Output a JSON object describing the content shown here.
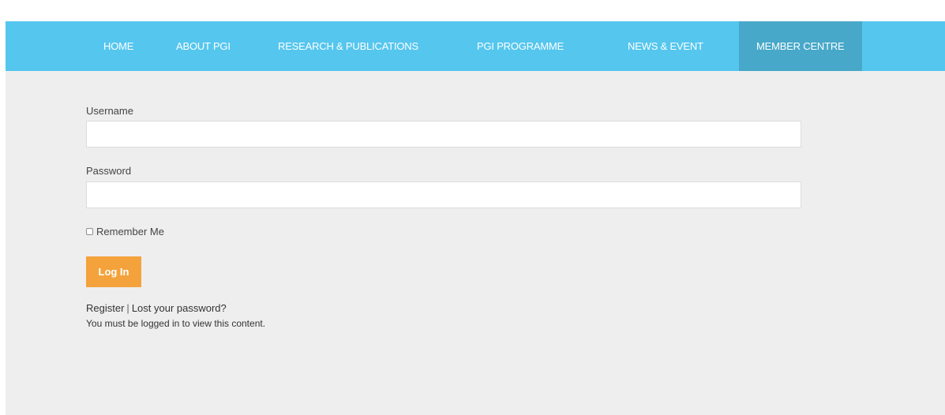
{
  "nav": {
    "items": [
      {
        "label": "HOME"
      },
      {
        "label": "ABOUT PGI"
      },
      {
        "label": "RESEARCH & PUBLICATIONS"
      },
      {
        "label": "PGI PROGRAMME"
      },
      {
        "label": "NEWS & EVENT"
      },
      {
        "label": "MEMBER CENTRE",
        "active": true
      }
    ]
  },
  "form": {
    "username_label": "Username",
    "username_value": "",
    "password_label": "Password",
    "password_value": "",
    "remember_label": "Remember Me",
    "login_label": "Log In"
  },
  "links": {
    "register": "Register",
    "separator": "|",
    "lost_password": "Lost your password?"
  },
  "notice": "You must be logged in to view this content.",
  "colors": {
    "nav_bg": "#55c6ee",
    "nav_active_bg": "#47a8c9",
    "page_bg": "#eeeeee",
    "button_bg": "#f4a23c"
  }
}
